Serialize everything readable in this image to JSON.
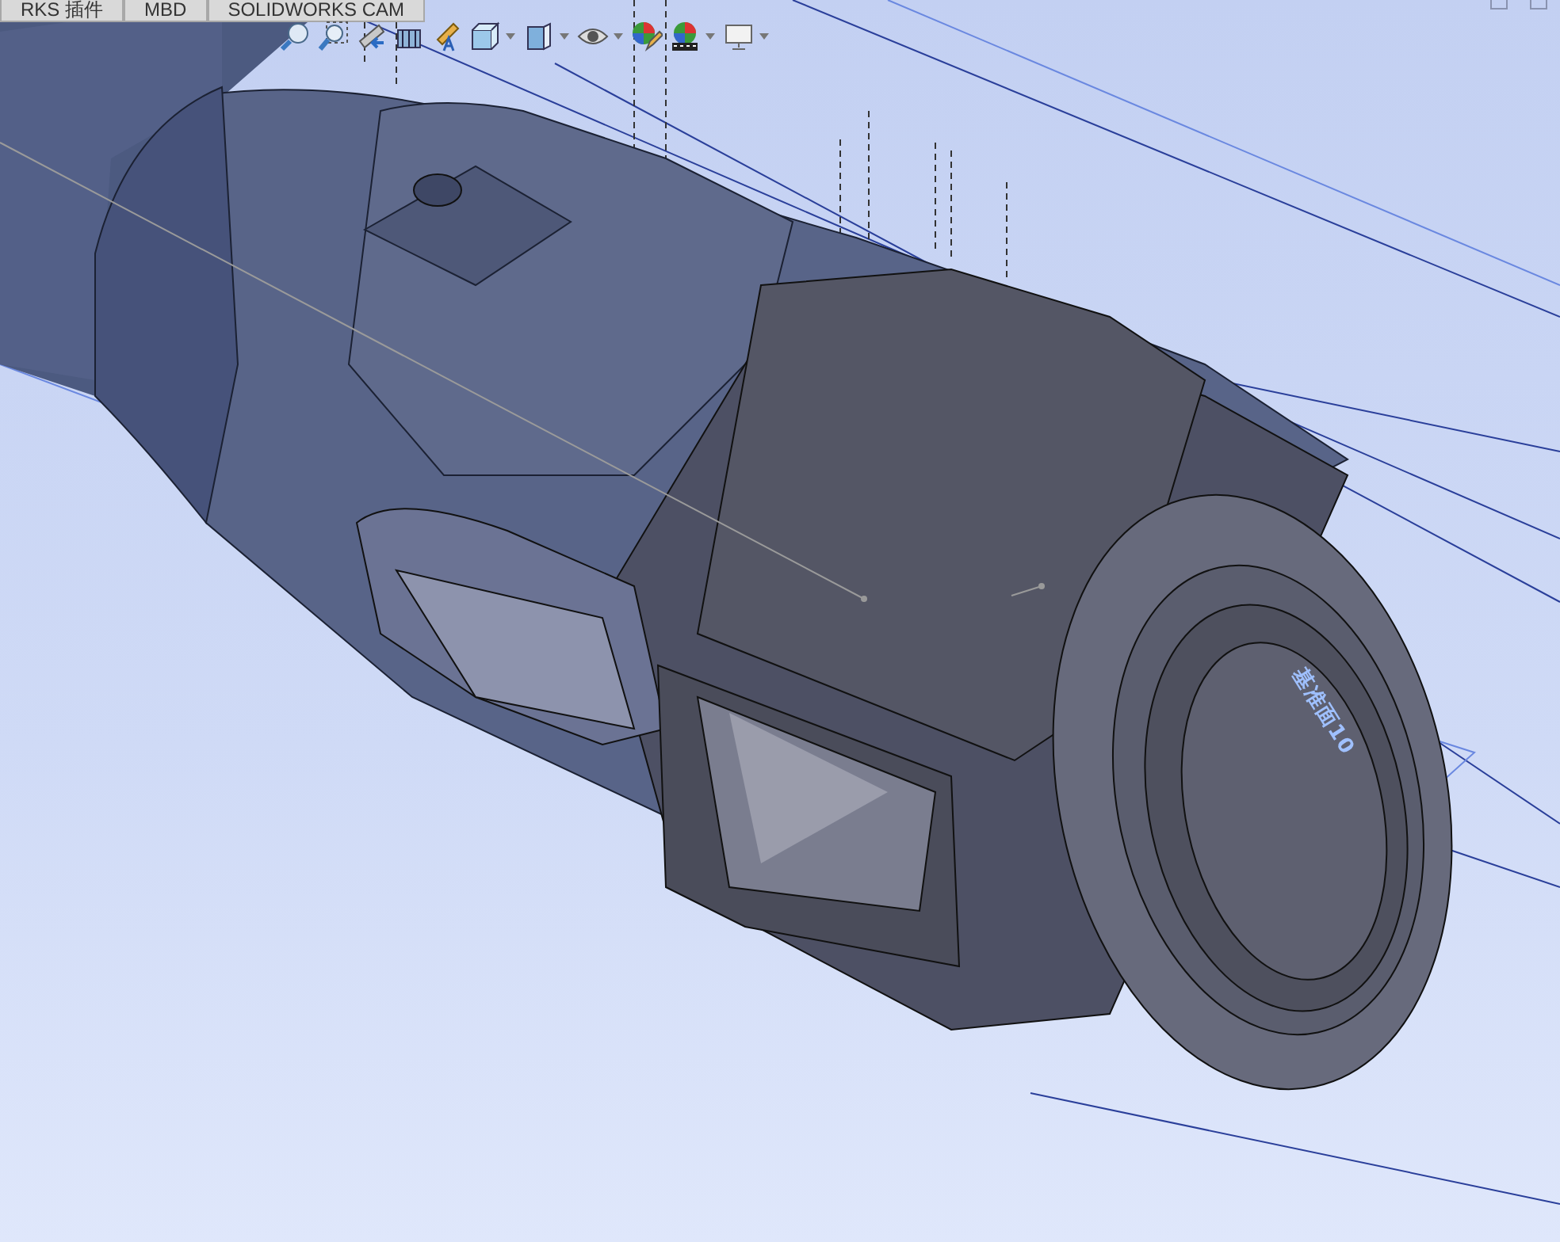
{
  "command_tabs": [
    {
      "label": "RKS 插件",
      "selected": false
    },
    {
      "label": "MBD",
      "selected": false
    },
    {
      "label": "SOLIDWORKS CAM",
      "selected": false
    }
  ],
  "heads_up_toolbar": [
    {
      "kind": "zoom-fit",
      "dropdown": false
    },
    {
      "kind": "zoom-area",
      "dropdown": false
    },
    {
      "kind": "previous-view",
      "dropdown": false
    },
    {
      "kind": "section-view",
      "dropdown": false
    },
    {
      "kind": "dynamic-annotation",
      "dropdown": false
    },
    {
      "kind": "view-orientation",
      "dropdown": true
    },
    {
      "kind": "display-style",
      "dropdown": true
    },
    {
      "kind": "hide-show",
      "dropdown": true
    },
    {
      "kind": "edit-appearance",
      "dropdown": false
    },
    {
      "kind": "apply-scene",
      "dropdown": true
    },
    {
      "kind": "view-settings",
      "dropdown": true
    }
  ],
  "viewport": {
    "plane_label": "基准面10"
  }
}
